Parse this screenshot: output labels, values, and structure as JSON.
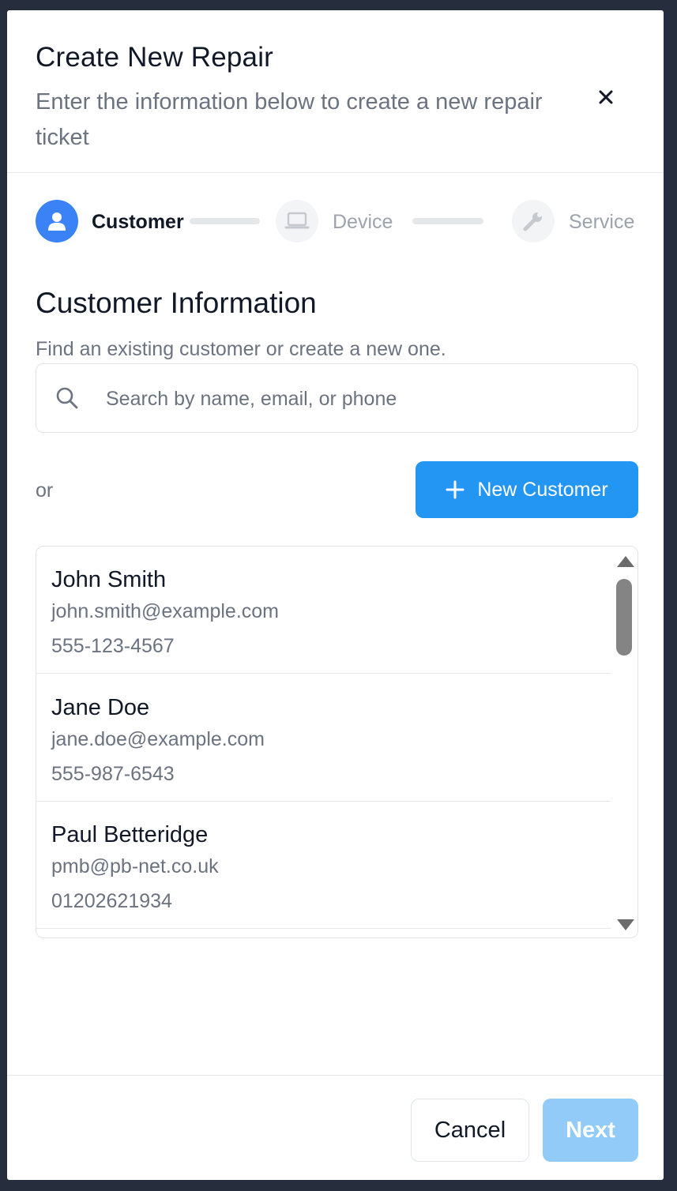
{
  "header": {
    "title": "Create New Repair",
    "subtitle": "Enter the information below to create a new repair ticket",
    "close_icon": "close-icon"
  },
  "stepper": {
    "steps": [
      {
        "label": "Customer",
        "icon": "user-icon",
        "state": "active"
      },
      {
        "label": "Device",
        "icon": "laptop-icon",
        "state": "inactive"
      },
      {
        "label": "Service",
        "icon": "wrench-icon",
        "state": "inactive"
      }
    ]
  },
  "section": {
    "title": "Customer Information",
    "description": "Find an existing customer or create a new one."
  },
  "search": {
    "placeholder": "Search by name, email, or phone",
    "value": ""
  },
  "or_text": "or",
  "new_customer_button": "New Customer",
  "customers": [
    {
      "name": "John Smith",
      "email": "john.smith@example.com",
      "phone": "555-123-4567"
    },
    {
      "name": "Jane Doe",
      "email": "jane.doe@example.com",
      "phone": "555-987-6543"
    },
    {
      "name": "Paul Betteridge",
      "email": "pmb@pb-net.co.uk",
      "phone": "01202621934"
    }
  ],
  "footer": {
    "cancel_label": "Cancel",
    "next_label": "Next"
  },
  "colors": {
    "accent": "#2395f3",
    "step_active": "#3b82f6",
    "next_disabled": "#92cbf8",
    "backdrop": "#262d3d"
  }
}
